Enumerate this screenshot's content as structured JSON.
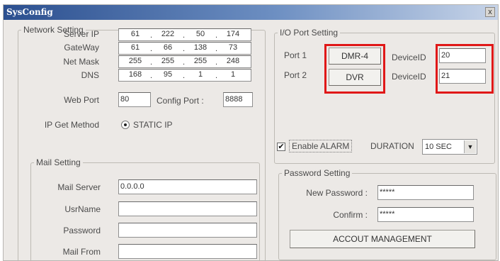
{
  "window": {
    "title": "SysConfig",
    "close_label": "x"
  },
  "network": {
    "legend": "Network Setting",
    "server_ip": {
      "label": "Server IP",
      "octets": [
        "61",
        "222",
        "50",
        "174"
      ]
    },
    "gateway": {
      "label": "GateWay",
      "octets": [
        "61",
        "66",
        "138",
        "73"
      ]
    },
    "net_mask": {
      "label": "Net Mask",
      "octets": [
        "255",
        "255",
        "255",
        "248"
      ]
    },
    "dns": {
      "label": "DNS",
      "octets": [
        "168",
        "95",
        "1",
        "1"
      ]
    },
    "web_port": {
      "label": "Web Port",
      "value": "80"
    },
    "config_port": {
      "label": "Config Port :",
      "value": "8888"
    },
    "ip_method": {
      "label": "IP Get Method",
      "option": "STATIC IP"
    }
  },
  "mail": {
    "legend": "Mail Setting",
    "server": {
      "label": "Mail Server",
      "value": "0.0.0.0"
    },
    "username": {
      "label": "UsrName",
      "value": ""
    },
    "password": {
      "label": "Password",
      "value": ""
    },
    "from": {
      "label": "Mail From",
      "value": ""
    }
  },
  "io": {
    "legend": "I/O Port Setting",
    "port1": {
      "label": "Port 1",
      "button": "DMR-4",
      "device_label": "DeviceID",
      "device_id": "20"
    },
    "port2": {
      "label": "Port 2",
      "button": "DVR",
      "device_label": "DeviceID",
      "device_id": "21"
    },
    "alarm": {
      "label": "Enable ALARM",
      "checked_mark": "✔"
    },
    "duration": {
      "label": "DURATION",
      "value": "10 SEC",
      "arrow": "▼"
    }
  },
  "password_setting": {
    "legend": "Password Setting",
    "new_password": {
      "label": "New Password :",
      "value": "*****"
    },
    "confirm": {
      "label": "Confirm :",
      "value": "*****"
    },
    "account_button": "ACCOUT MANAGEMENT"
  },
  "colors": {
    "highlight": "#e01818",
    "titlebar": "#2b4f8f"
  }
}
